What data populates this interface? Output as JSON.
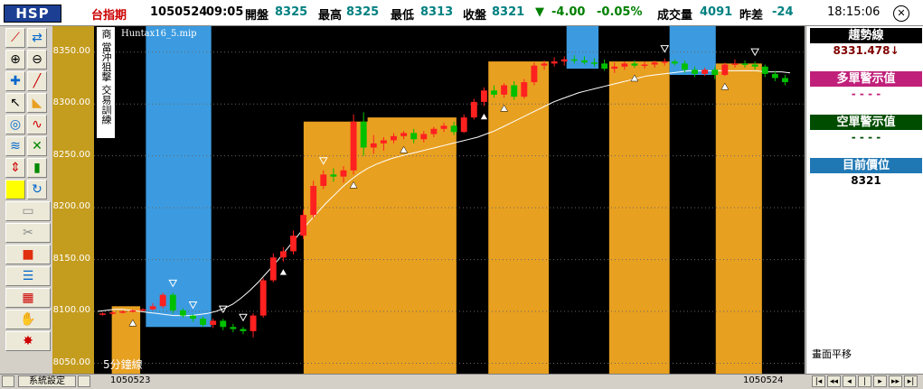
{
  "header": {
    "logo": "HSP",
    "symbol": "台指期",
    "date": "1050524",
    "time": "09:05",
    "open_label": "開盤",
    "open_value": "8325",
    "high_label": "最高",
    "high_value": "8325",
    "low_label": "最低",
    "low_value": "8313",
    "close_label": "收盤",
    "close_value": "8321",
    "change_arrow": "▼",
    "change_value": "-4.00",
    "change_pct": "-0.05%",
    "volume_label": "成交量",
    "volume_value": "4091",
    "spread_label": "昨差",
    "spread_value": "-24",
    "clock": "18:15:06",
    "close_icon": "x-icon"
  },
  "toolbar": {
    "side_labels": [
      "商",
      "當沖狙擊",
      "交易訓練"
    ],
    "icons": [
      "pen-icon",
      "zoom-fit-icon",
      "zoom-in-icon",
      "zoom-out-icon",
      "crosshair-icon",
      "line-icon",
      "pointer-icon",
      "pencil-icon",
      "target-icon",
      "wave-icon",
      "fibonacci-icon",
      "cross-arrows-icon",
      "up-down-icon",
      "bar-icon",
      "yellow-box-icon",
      "refresh-icon",
      "folder-icon",
      "cut-icon",
      "stop-icon",
      "list-icon",
      "grid-icon",
      "hands-icon",
      "star-icon"
    ]
  },
  "chart_data": {
    "type": "candlestick",
    "title": "Huntax16_5.mip",
    "period_label": "5分鐘線",
    "ylim": [
      8040,
      8375
    ],
    "y_ticks": [
      "8350.00",
      "8300.00",
      "8250.00",
      "8200.00",
      "8150.00",
      "8100.00",
      "8050.00"
    ],
    "x_labels": [
      "1050523",
      "1050524"
    ],
    "trend_line_values": [
      8100,
      8101,
      8102,
      8102,
      8101,
      8100,
      8099,
      8098,
      8097,
      8096,
      8096,
      8096,
      8097,
      8098,
      8100,
      8103,
      8107,
      8113,
      8120,
      8128,
      8137,
      8146,
      8156,
      8166,
      8176,
      8186,
      8195,
      8204,
      8212,
      8220,
      8227,
      8233,
      8238,
      8242,
      8245,
      8248,
      8250,
      8252,
      8254,
      8256,
      8258,
      8260,
      8262,
      8264,
      8266,
      8268,
      8271,
      8274,
      8278,
      8282,
      8286,
      8290,
      8294,
      8298,
      8302,
      8305,
      8308,
      8311,
      8313,
      8315,
      8317,
      8319,
      8321,
      8323,
      8325,
      8327,
      8328,
      8329,
      8330,
      8331,
      8332,
      8332,
      8332,
      8332,
      8332,
      8332,
      8332,
      8332,
      8332,
      8331,
      8331,
      8331,
      8330
    ],
    "candles": [
      [
        8097,
        8099,
        8096,
        8098
      ],
      [
        8098,
        8100,
        8097,
        8099
      ],
      [
        8099,
        8101,
        8098,
        8100
      ],
      [
        8100,
        8102,
        8099,
        8101
      ],
      [
        8101,
        8103,
        8100,
        8102
      ],
      [
        8102,
        8108,
        8101,
        8105
      ],
      [
        8105,
        8118,
        8103,
        8116
      ],
      [
        8116,
        8118,
        8098,
        8101
      ],
      [
        8101,
        8103,
        8094,
        8096
      ],
      [
        8096,
        8097,
        8090,
        8093
      ],
      [
        8093,
        8095,
        8085,
        8087
      ],
      [
        8087,
        8093,
        8084,
        8091
      ],
      [
        8091,
        8093,
        8082,
        8085
      ],
      [
        8085,
        8088,
        8080,
        8083
      ],
      [
        8083,
        8085,
        8078,
        8081
      ],
      [
        8081,
        8098,
        8075,
        8096
      ],
      [
        8096,
        8132,
        8094,
        8130
      ],
      [
        8130,
        8156,
        8128,
        8152
      ],
      [
        8152,
        8162,
        8148,
        8158
      ],
      [
        8158,
        8178,
        8155,
        8173
      ],
      [
        8173,
        8198,
        8170,
        8193
      ],
      [
        8193,
        8226,
        8190,
        8221
      ],
      [
        8221,
        8236,
        8218,
        8232
      ],
      [
        8232,
        8238,
        8225,
        8230
      ],
      [
        8230,
        8240,
        8224,
        8236
      ],
      [
        8236,
        8290,
        8232,
        8283
      ],
      [
        8283,
        8292,
        8250,
        8258
      ],
      [
        8258,
        8270,
        8252,
        8262
      ],
      [
        8262,
        8268,
        8255,
        8265
      ],
      [
        8265,
        8272,
        8262,
        8269
      ],
      [
        8269,
        8274,
        8266,
        8272
      ],
      [
        8272,
        8276,
        8262,
        8266
      ],
      [
        8266,
        8274,
        8263,
        8271
      ],
      [
        8271,
        8278,
        8268,
        8276
      ],
      [
        8276,
        8282,
        8273,
        8279
      ],
      [
        8279,
        8283,
        8270,
        8273
      ],
      [
        8273,
        8290,
        8272,
        8287
      ],
      [
        8287,
        8305,
        8285,
        8302
      ],
      [
        8302,
        8316,
        8298,
        8313
      ],
      [
        8313,
        8318,
        8306,
        8309
      ],
      [
        8309,
        8320,
        8306,
        8318
      ],
      [
        8318,
        8322,
        8304,
        8307
      ],
      [
        8307,
        8324,
        8305,
        8321
      ],
      [
        8321,
        8340,
        8318,
        8337
      ],
      [
        8337,
        8342,
        8333,
        8339
      ],
      [
        8339,
        8345,
        8336,
        8341
      ],
      [
        8341,
        8346,
        8337,
        8343
      ],
      [
        8343,
        8347,
        8339,
        8342
      ],
      [
        8342,
        8346,
        8338,
        8340
      ],
      [
        8340,
        8344,
        8336,
        8339
      ],
      [
        8339,
        8343,
        8332,
        8334
      ],
      [
        8334,
        8340,
        8330,
        8336
      ],
      [
        8336,
        8341,
        8333,
        8339
      ],
      [
        8339,
        8342,
        8335,
        8337
      ],
      [
        8337,
        8341,
        8334,
        8338
      ],
      [
        8338,
        8342,
        8335,
        8340
      ],
      [
        8340,
        8344,
        8337,
        8341
      ],
      [
        8341,
        8343,
        8337,
        8339
      ],
      [
        8339,
        8342,
        8330,
        8333
      ],
      [
        8333,
        8336,
        8326,
        8329
      ],
      [
        8329,
        8335,
        8327,
        8333
      ],
      [
        8333,
        8336,
        8324,
        8328
      ],
      [
        8328,
        8340,
        8327,
        8338
      ],
      [
        8338,
        8343,
        8335,
        8339
      ],
      [
        8339,
        8342,
        8335,
        8338
      ],
      [
        8338,
        8341,
        8333,
        8336
      ],
      [
        8336,
        8338,
        8326,
        8329
      ],
      [
        8329,
        8332,
        8322,
        8325
      ],
      [
        8325,
        8328,
        8318,
        8321
      ]
    ],
    "buy_zones": [
      [
        0.025,
        0.065
      ],
      [
        0.295,
        0.41
      ],
      [
        0.385,
        0.51
      ],
      [
        0.555,
        0.64
      ],
      [
        0.725,
        0.81
      ],
      [
        0.875,
        0.94
      ]
    ],
    "sell_zones": [
      [
        0.073,
        0.165
      ],
      [
        0.665,
        0.71
      ],
      [
        0.81,
        0.875
      ]
    ],
    "buy_signal_indices": [
      3,
      18,
      25,
      30,
      38,
      40,
      53,
      62
    ],
    "sell_signal_indices": [
      7,
      9,
      12,
      14,
      22,
      56,
      65
    ]
  },
  "right_panel": {
    "trend_label": "趨勢線",
    "trend_value": "8331.478↓",
    "long_label": "多單警示值",
    "long_value": "- - - -",
    "short_label": "空單警示值",
    "short_value": "- - - -",
    "position_label": "目前價位",
    "position_value": "8321",
    "pan_label": "畫面平移"
  },
  "footer": {
    "settings_button": "系統設定",
    "x_left_label": "1050523",
    "x_right_label": "1050524"
  },
  "colors": {
    "up": "#ff2020",
    "down": "#00c000",
    "buy_zone": "#e8a020",
    "sell_zone": "#3c9be0",
    "trend": "#ffffff"
  }
}
